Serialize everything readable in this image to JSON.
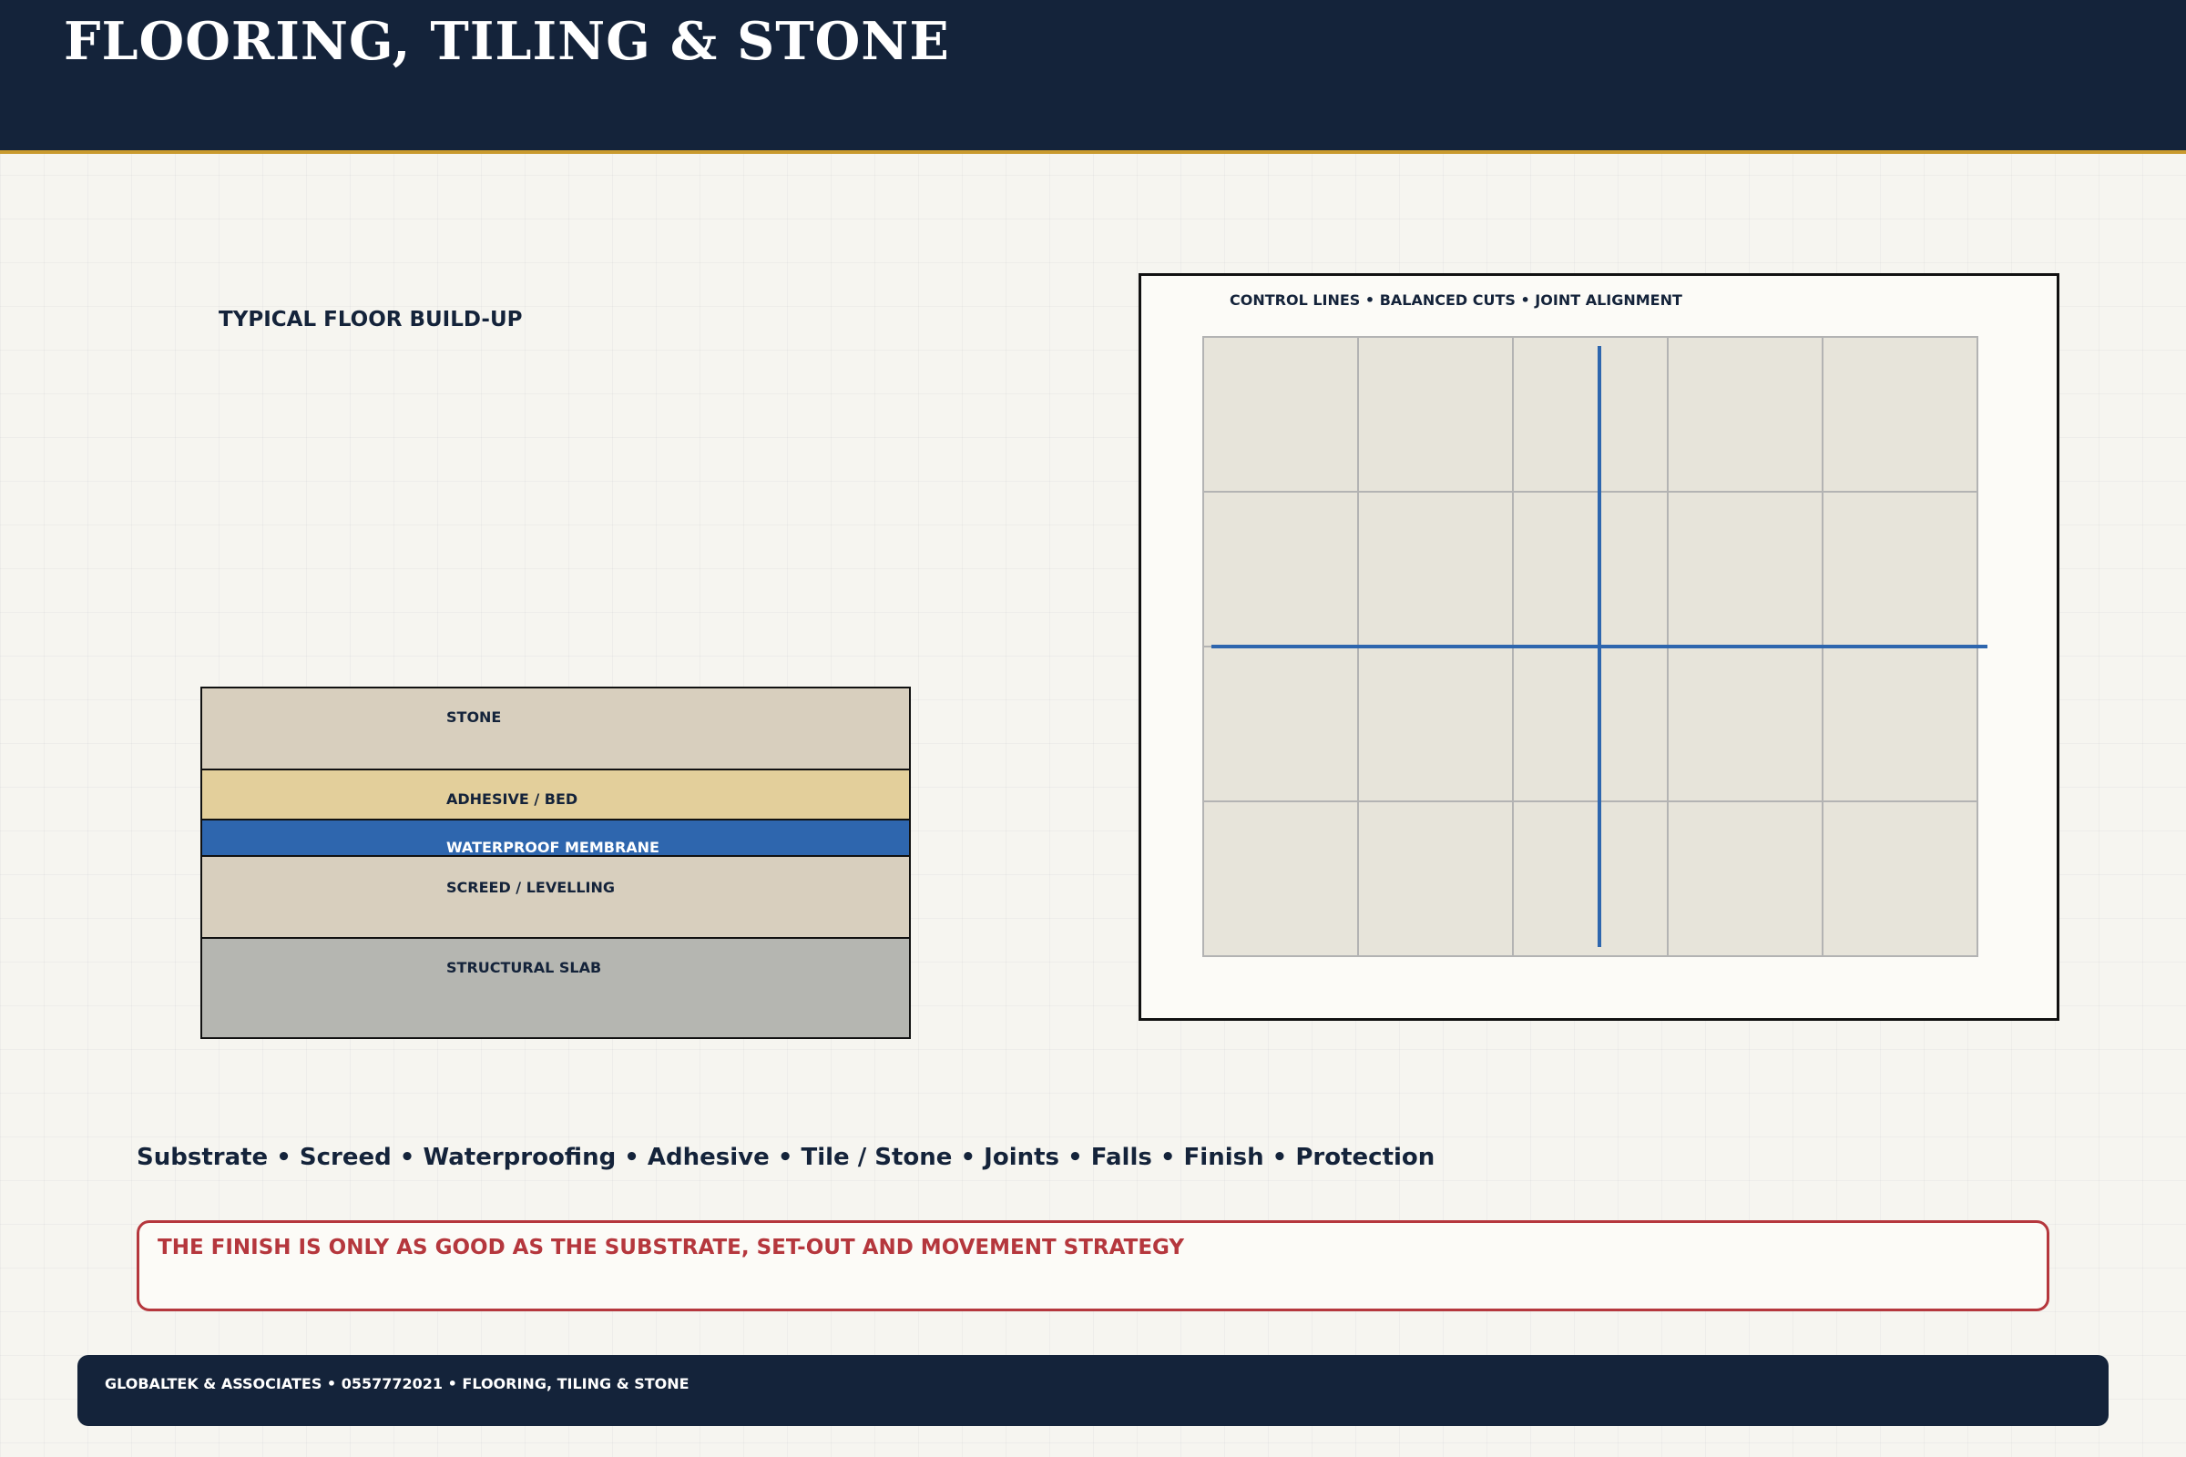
{
  "header": {
    "title": "FLOORING, TILING & STONE"
  },
  "buildup": {
    "title": "TYPICAL FLOOR BUILD-UP",
    "layers": [
      {
        "label": "STONE",
        "color": "#d8cfbe"
      },
      {
        "label": "ADHESIVE / BED",
        "color": "#e3cf9b"
      },
      {
        "label": "WATERPROOF MEMBRANE",
        "color": "#2e66ae"
      },
      {
        "label": "SCREED / LEVELLING",
        "color": "#d8cfbe"
      },
      {
        "label": "STRUCTURAL SLAB",
        "color": "#b5b6b1"
      }
    ]
  },
  "setout": {
    "title": "CONTROL LINES • BALANCED CUTS • JOINT ALIGNMENT",
    "tile_columns": 5,
    "tile_rows": 4,
    "tile_color": "#e7e4da",
    "grout_color": "#b3b3b3",
    "control_line_color": "#2e66ae"
  },
  "tagline": "Substrate • Screed • Waterproofing • Adhesive • Tile / Stone • Joints • Falls • Finish • Protection",
  "warning": {
    "text": "THE FINISH IS ONLY AS GOOD AS THE SUBSTRATE, SET-OUT AND MOVEMENT STRATEGY",
    "color": "#b5373d"
  },
  "footer": {
    "text": "GLOBALTEK & ASSOCIATES • 0557772021 • FLOORING, TILING & STONE"
  },
  "colors": {
    "navy": "#14233a",
    "gold_accent": "#c99a2e",
    "background": "#f6f5f0"
  }
}
